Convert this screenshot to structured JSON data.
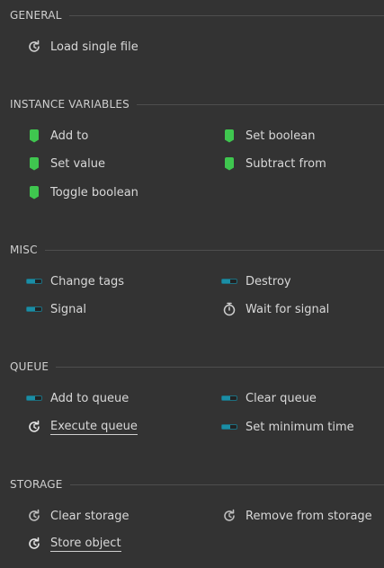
{
  "sections": {
    "general": {
      "title": "GENERAL",
      "items": [
        {
          "label": "Load single file",
          "icon": "refresh-icon"
        }
      ]
    },
    "instance_variables": {
      "title": "INSTANCE VARIABLES",
      "items": [
        {
          "label": "Add to",
          "icon": "bookmark-icon"
        },
        {
          "label": "Set boolean",
          "icon": "bookmark-icon"
        },
        {
          "label": "Set value",
          "icon": "bookmark-icon"
        },
        {
          "label": "Subtract from",
          "icon": "bookmark-icon"
        },
        {
          "label": "Toggle boolean",
          "icon": "bookmark-icon"
        }
      ]
    },
    "misc": {
      "title": "MISC",
      "items": [
        {
          "label": "Change tags",
          "icon": "bar-icon"
        },
        {
          "label": "Destroy",
          "icon": "bar-icon"
        },
        {
          "label": "Signal",
          "icon": "bar-icon"
        },
        {
          "label": "Wait for signal",
          "icon": "stopwatch-icon"
        }
      ]
    },
    "queue": {
      "title": "QUEUE",
      "items": [
        {
          "label": "Add to queue",
          "icon": "bar-icon"
        },
        {
          "label": "Clear queue",
          "icon": "bar-icon"
        },
        {
          "label": "Execute queue",
          "icon": "refresh-icon"
        },
        {
          "label": "Set minimum time",
          "icon": "bar-icon"
        }
      ]
    },
    "storage": {
      "title": "STORAGE",
      "items": [
        {
          "label": "Clear storage",
          "icon": "refresh-icon"
        },
        {
          "label": "Remove from storage",
          "icon": "refresh-icon"
        },
        {
          "label": "Store object",
          "icon": "refresh-icon"
        }
      ]
    }
  },
  "colors": {
    "background": "#333333",
    "bookmark_green": "#3fc64f",
    "bar_teal": "#1a8ea6"
  }
}
